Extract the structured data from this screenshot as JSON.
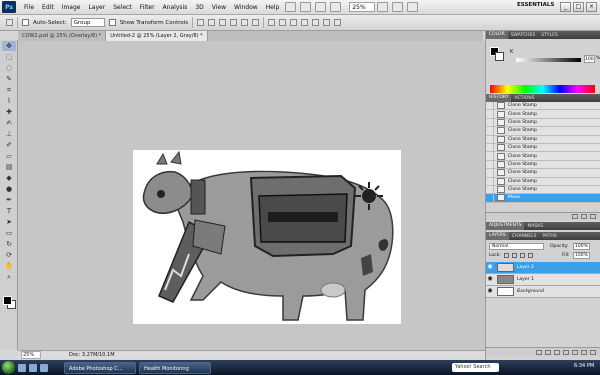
{
  "menubar": {
    "logo": "Ps",
    "items": [
      "File",
      "Edit",
      "Image",
      "Layer",
      "Select",
      "Filter",
      "Analysis",
      "3D",
      "View",
      "Window",
      "Help"
    ],
    "zoom": "25%",
    "workspace": "ESSENTIALS",
    "win_buttons": [
      "_",
      "□",
      "×"
    ]
  },
  "optionsbar": {
    "auto_select_label": "Auto-Select:",
    "auto_select_value": "Group",
    "show_transform_label": "Show Transform Controls"
  },
  "tabs": [
    {
      "label": "COW2.psd @ 25% (Overlay/8) *",
      "active": false
    },
    {
      "label": "Untitled-2 @ 25% (Layer 2, Gray/8) *",
      "active": true
    }
  ],
  "status": {
    "zoom": "25%",
    "doc": "Doc: 3.27M/10.1M"
  },
  "color_panel": {
    "tabs": [
      "COLOR",
      "SWATCHES",
      "STYLES"
    ],
    "channel": "K",
    "value": "100",
    "unit": "%"
  },
  "history_panel": {
    "tabs": [
      "HISTORY",
      "ACTIONS"
    ],
    "items": [
      "Clone Stamp",
      "Clone Stamp",
      "Clone Stamp",
      "Clone Stamp",
      "Clone Stamp",
      "Clone Stamp",
      "Clone Stamp",
      "Clone Stamp",
      "Clone Stamp",
      "Clone Stamp",
      "Clone Stamp",
      "Move"
    ],
    "selected_index": 11
  },
  "adjustments_panel": {
    "tabs": [
      "ADJUSTMENTS",
      "MASKS"
    ]
  },
  "layers_panel": {
    "tabs": [
      "LAYERS",
      "CHANNELS",
      "PATHS"
    ],
    "blend_mode": "Normal",
    "opacity_label": "Opacity:",
    "opacity": "100%",
    "lock_label": "Lock:",
    "fill_label": "Fill:",
    "fill": "100%",
    "layers": [
      {
        "name": "Layer 2",
        "selected": true
      },
      {
        "name": "Layer 1",
        "selected": false
      },
      {
        "name": "Background",
        "selected": false
      }
    ]
  },
  "taskbar": {
    "buttons": [
      "Adobe Photoshop C...",
      "Health Monitoring"
    ],
    "search": "Yahoo! Search",
    "time": "6:34 PM"
  }
}
